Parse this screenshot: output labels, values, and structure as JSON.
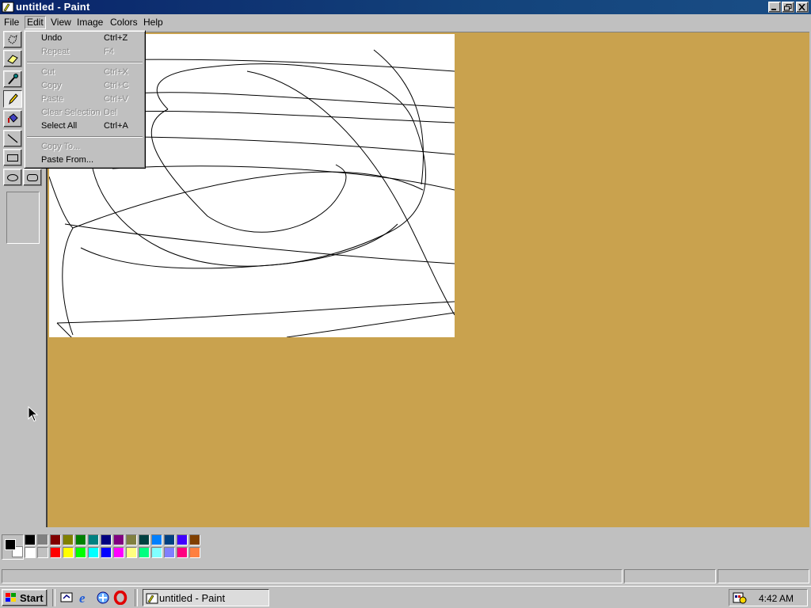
{
  "window": {
    "title": "untitled - Paint"
  },
  "menubar": {
    "items": [
      "File",
      "Edit",
      "View",
      "Image",
      "Colors",
      "Help"
    ]
  },
  "edit_menu": {
    "items": [
      {
        "label": "Undo",
        "shortcut": "Ctrl+Z",
        "enabled": true
      },
      {
        "label": "Repeat",
        "shortcut": "F4",
        "enabled": false
      },
      {
        "label": "Cut",
        "shortcut": "Ctrl+X",
        "enabled": false
      },
      {
        "label": "Copy",
        "shortcut": "Ctrl+C",
        "enabled": false
      },
      {
        "label": "Paste",
        "shortcut": "Ctrl+V",
        "enabled": false
      },
      {
        "label": "Clear Selection",
        "shortcut": "Del",
        "enabled": false
      },
      {
        "label": "Select All",
        "shortcut": "Ctrl+A",
        "enabled": true
      },
      {
        "label": "Copy To...",
        "shortcut": "",
        "enabled": false
      },
      {
        "label": "Paste From...",
        "shortcut": "",
        "enabled": true
      }
    ]
  },
  "toolbox": {
    "tools": [
      "free-form-select-icon",
      "eraser-icon",
      "color-picker-icon",
      "pencil-icon",
      "fill-icon",
      "line-icon",
      "rectangle-icon",
      "ellipse-icon",
      "rounded-rectangle-icon"
    ],
    "selected": "pencil-icon"
  },
  "palette": {
    "foreground": "#000000",
    "background": "#ffffff",
    "row1": [
      "#000000",
      "#808080",
      "#800000",
      "#808000",
      "#008000",
      "#008080",
      "#000080",
      "#800080",
      "#808040",
      "#004040",
      "#0080ff",
      "#004080",
      "#4000ff",
      "#804000"
    ],
    "row2": [
      "#ffffff",
      "#c0c0c0",
      "#ff0000",
      "#ffff00",
      "#00ff00",
      "#00ffff",
      "#0000ff",
      "#ff00ff",
      "#ffff80",
      "#00ff80",
      "#80ffff",
      "#8080ff",
      "#ff0080",
      "#ff8040"
    ]
  },
  "colors": {
    "workspace": "#c9a24e",
    "titlebar": "#0a246a"
  },
  "taskbar": {
    "start_label": "Start",
    "task_label": "untitled - Paint",
    "clock": "4:42 AM",
    "quick_launch": [
      "desktop-icon",
      "ie-icon",
      "channels-icon",
      "opera-icon"
    ]
  }
}
